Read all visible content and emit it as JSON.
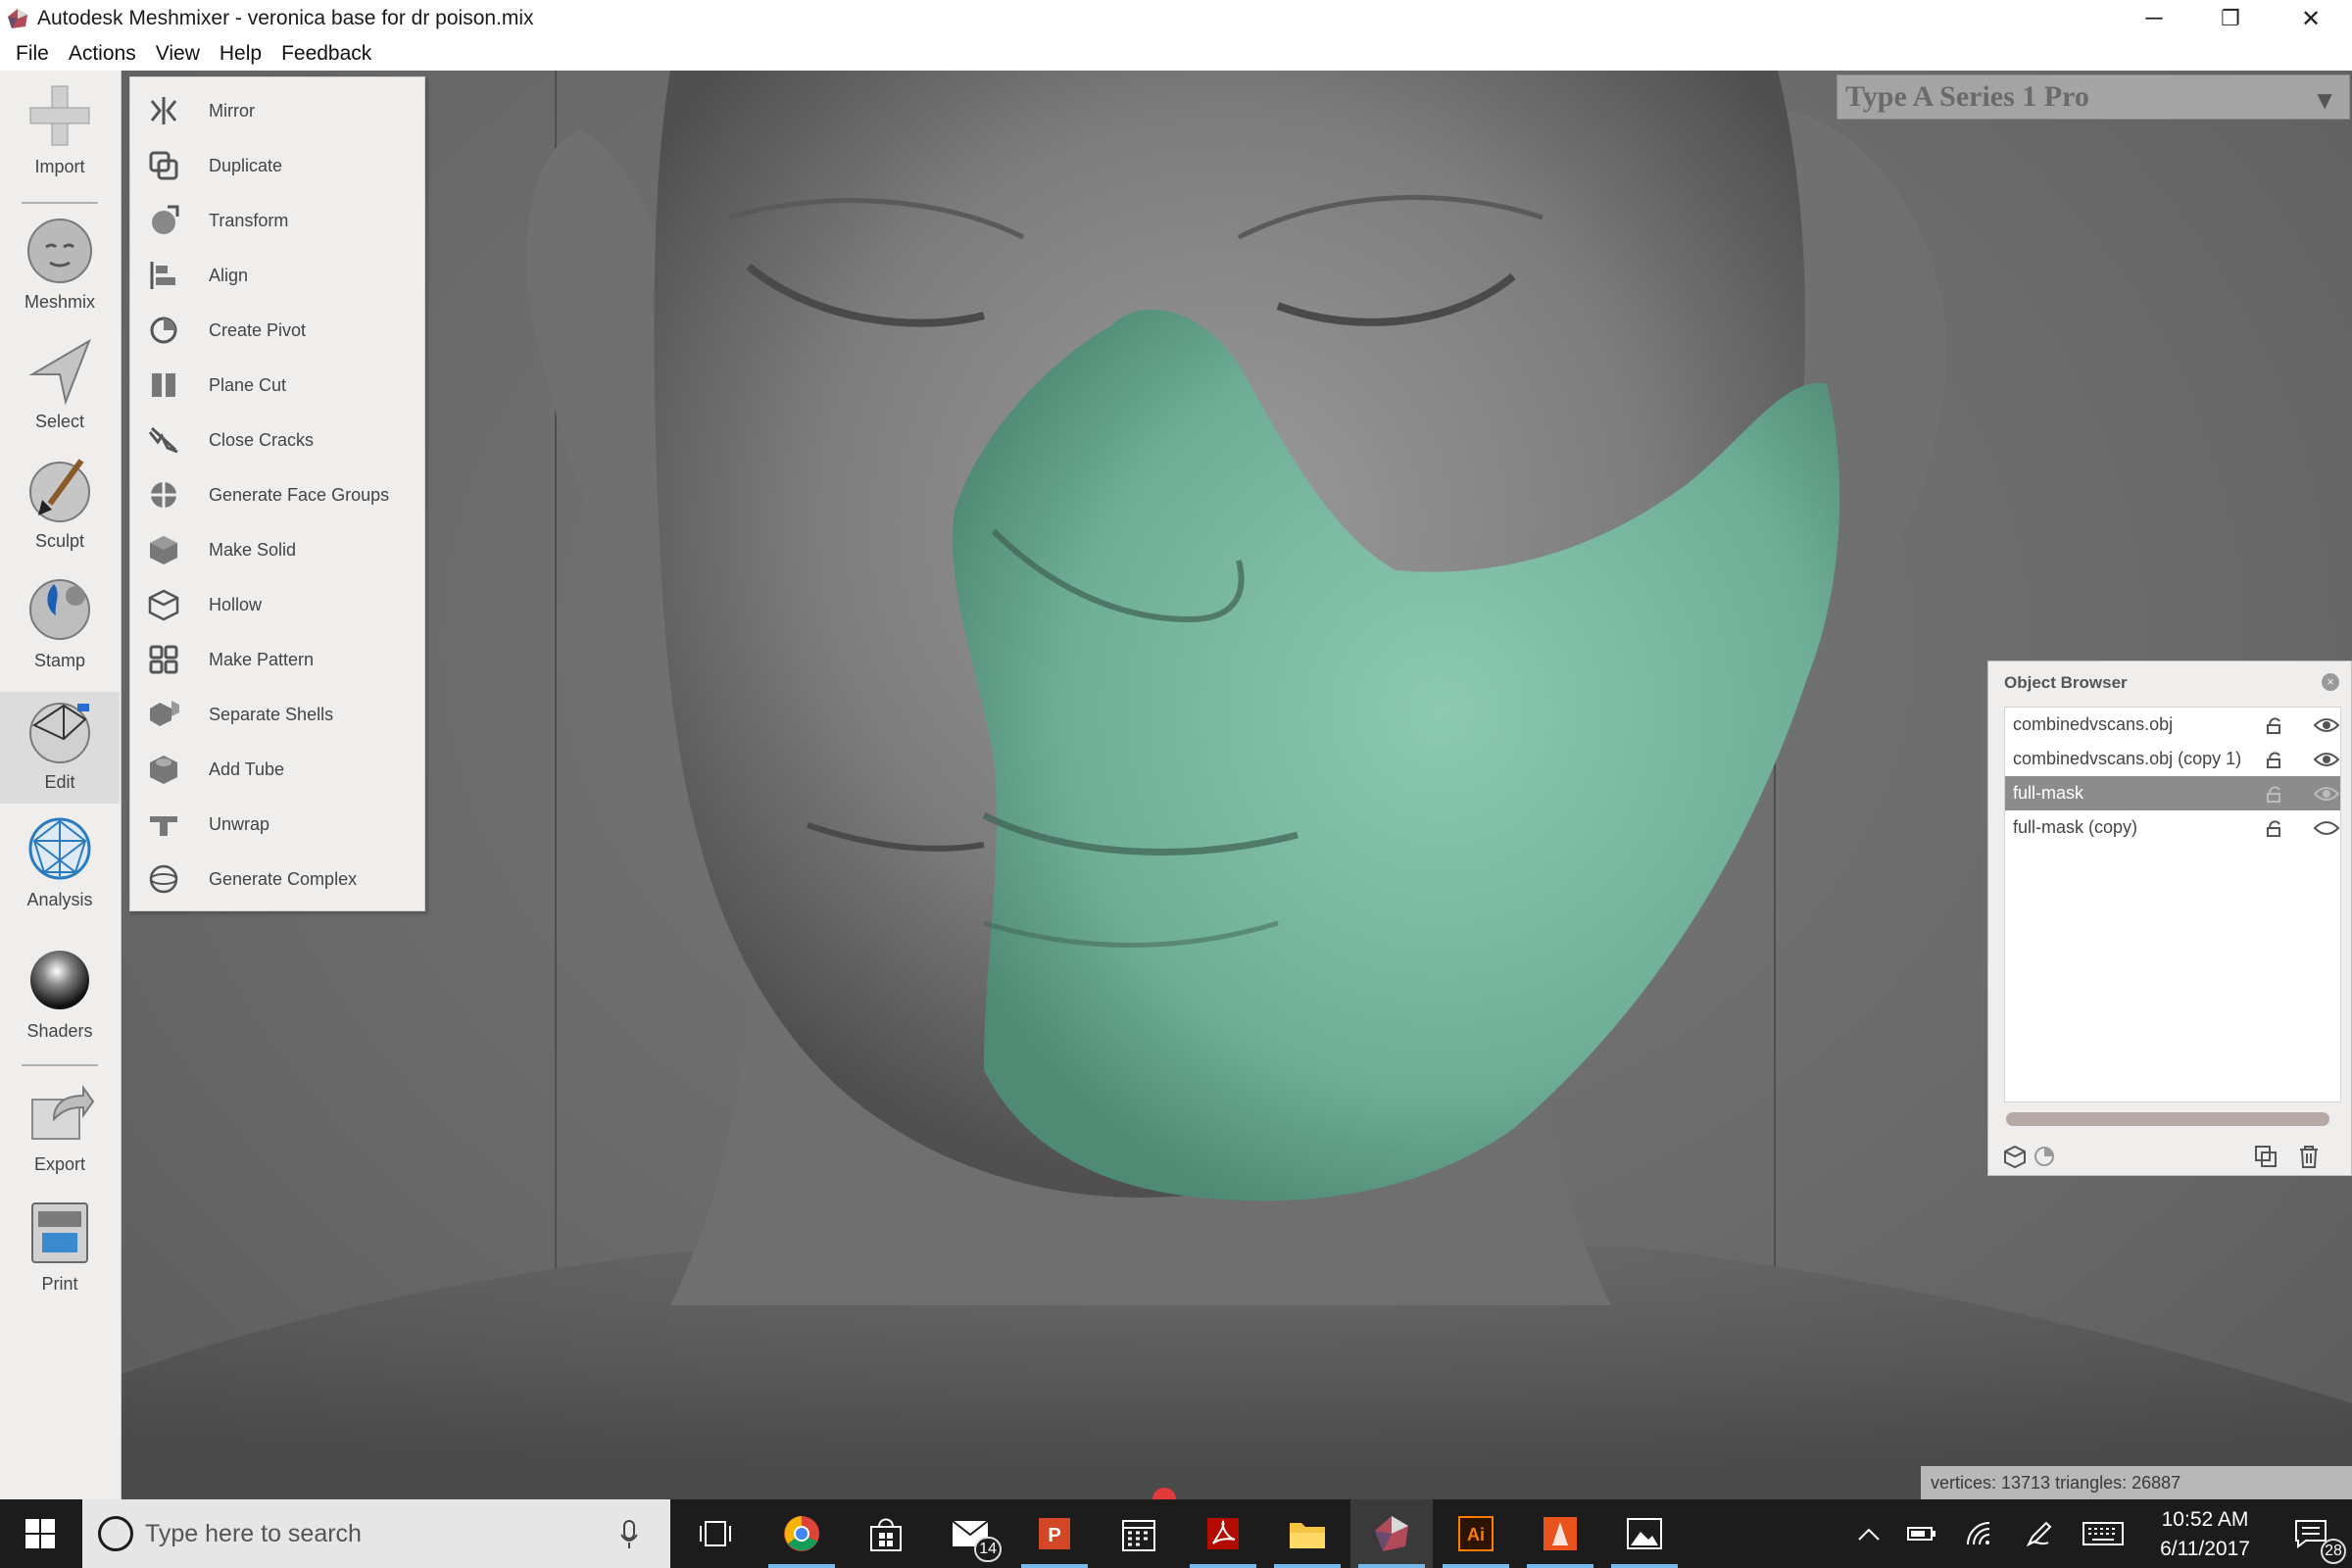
{
  "window": {
    "title": "Autodesk Meshmixer - veronica base for dr poison.mix",
    "minimize": "─",
    "restore": "❐",
    "close": "✕"
  },
  "menu": {
    "file": "File",
    "actions": "Actions",
    "view": "View",
    "help": "Help",
    "feedback": "Feedback"
  },
  "toolbar": {
    "import": "Import",
    "meshmix": "Meshmix",
    "select": "Select",
    "sculpt": "Sculpt",
    "stamp": "Stamp",
    "edit": "Edit",
    "analysis": "Analysis",
    "shaders": "Shaders",
    "export": "Export",
    "print": "Print"
  },
  "edit_menu": {
    "items": [
      {
        "label": "Mirror"
      },
      {
        "label": "Duplicate"
      },
      {
        "label": "Transform"
      },
      {
        "label": "Align"
      },
      {
        "label": "Create Pivot"
      },
      {
        "label": "Plane Cut"
      },
      {
        "label": "Close Cracks"
      },
      {
        "label": "Generate Face Groups"
      },
      {
        "label": "Make Solid"
      },
      {
        "label": "Hollow"
      },
      {
        "label": "Make Pattern"
      },
      {
        "label": "Separate Shells"
      },
      {
        "label": "Add Tube"
      },
      {
        "label": "Unwrap"
      },
      {
        "label": "Generate Complex"
      }
    ]
  },
  "printer": {
    "name": "Type A Series 1 Pro",
    "arrow": "▼"
  },
  "object_browser": {
    "title": "Object Browser",
    "close": "×",
    "objects": [
      {
        "name": "combinedvscans.obj"
      },
      {
        "name": "combinedvscans.obj (copy 1)"
      },
      {
        "name": "full-mask"
      },
      {
        "name": "full-mask (copy)"
      }
    ],
    "selected_index": 2
  },
  "stats": {
    "text": "vertices: 13713 triangles: 26887"
  },
  "taskbar": {
    "search_placeholder": "Type here to search",
    "mail_badge": "14",
    "time": "10:52 AM",
    "date": "6/11/2017",
    "notifications": "28"
  },
  "colors": {
    "mask": "#6fae97",
    "accent": "#76b9ed"
  }
}
